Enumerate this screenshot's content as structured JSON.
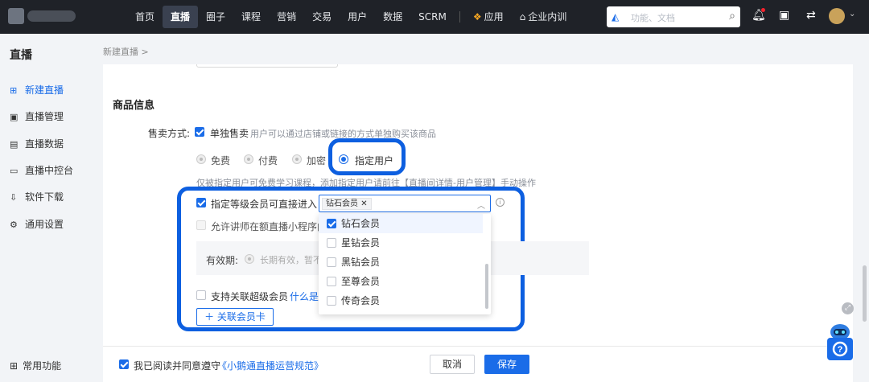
{
  "topbar": {
    "nav": [
      "首页",
      "直播",
      "圈子",
      "课程",
      "营销",
      "交易",
      "用户",
      "数据",
      "SCRM",
      "应用",
      "企业内训"
    ],
    "active_nav": "直播",
    "search_placeholder": "功能、文档"
  },
  "sidebar": {
    "title": "直播",
    "items": [
      {
        "label": "新建直播",
        "icon": "new-live-icon",
        "active": true
      },
      {
        "label": "直播管理",
        "icon": "manage-icon",
        "active": false
      },
      {
        "label": "直播数据",
        "icon": "data-icon",
        "active": false
      },
      {
        "label": "直播中控台",
        "icon": "console-icon",
        "active": false
      },
      {
        "label": "软件下载",
        "icon": "download-icon",
        "active": false
      },
      {
        "label": "通用设置",
        "icon": "gear-icon",
        "active": false
      }
    ],
    "bottom_label": "常用功能"
  },
  "breadcrumb": "新建直播 >",
  "product": {
    "section_title": "商品信息",
    "sale_mode_label": "售卖方式:",
    "single_sale_label": "单独售卖",
    "single_sale_hint": "用户可以通过店铺或链接的方式单独购买该商品",
    "price_options": [
      "免费",
      "付费",
      "加密",
      "指定用户"
    ],
    "selected_option": "指定用户",
    "specified_hint": "仅被指定用户可免费学习课程，添加指定用户请前往【直播间详情-用户管理】手动操作",
    "member_level_label": "指定等级会员可直接进入",
    "selected_tag": "钻石会员",
    "allow_lecturer_label": "允许讲师在额直播小程序内邀",
    "validity_label": "有效期:",
    "validity_value": "长期有效，暂不",
    "super_member_label": "支持关联超级会员",
    "super_member_link": "什么是",
    "add_card_button": "关联会员卡",
    "dropdown_options": [
      {
        "label": "钻石会员",
        "checked": true
      },
      {
        "label": "星钻会员",
        "checked": false
      },
      {
        "label": "黑钻会员",
        "checked": false
      },
      {
        "label": "至尊会员",
        "checked": false
      },
      {
        "label": "传奇会员",
        "checked": false
      }
    ]
  },
  "footer": {
    "agree_text": "我已阅读并同意遵守",
    "agree_link": "《小鹅通直播运营规范》",
    "cancel": "取消",
    "save": "保存"
  },
  "colors": {
    "accent": "#1a6ce8",
    "highlight": "#0d5fe0",
    "topbar": "#1f2228"
  }
}
